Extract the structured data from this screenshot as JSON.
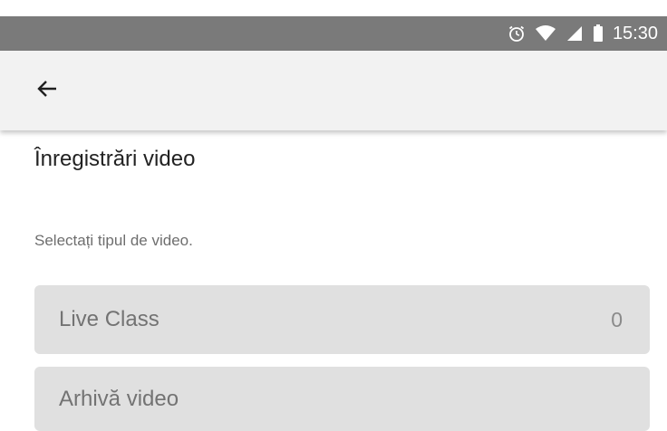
{
  "status_bar": {
    "time": "15:30",
    "icons": [
      "alarm-icon",
      "wifi-icon",
      "signal-icon",
      "battery-icon"
    ]
  },
  "app_bar": {
    "back_icon": "arrow-left-icon"
  },
  "main": {
    "title": "Înregistrări video",
    "subtitle": "Selectați tipul de video.",
    "options": [
      {
        "label": "Live Class",
        "count": "0"
      },
      {
        "label": "Arhivă video"
      }
    ]
  },
  "colors": {
    "status_bar": "#7a7a7a",
    "app_bar": "#f2f2f2",
    "card": "#e0e0e0",
    "card_text": "#737373"
  }
}
